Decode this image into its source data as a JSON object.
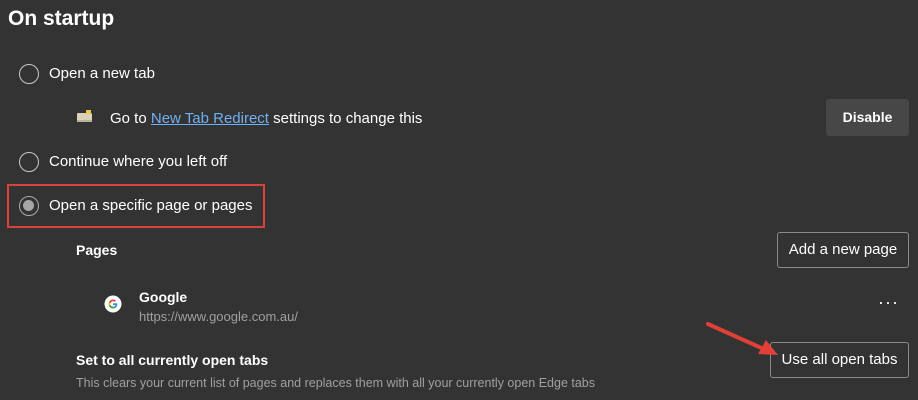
{
  "section": {
    "title": "On startup"
  },
  "options": {
    "new_tab": "Open a new tab",
    "continue": "Continue where you left off",
    "specific": "Open a specific page or pages"
  },
  "redirect": {
    "prefix": "Go to",
    "link": "New Tab Redirect",
    "suffix": "settings to change this",
    "disable_label": "Disable"
  },
  "pages": {
    "heading": "Pages",
    "add_label": "Add a new page",
    "items": [
      {
        "name": "Google",
        "url": "https://www.google.com.au/",
        "more": "···"
      }
    ]
  },
  "open_tabs": {
    "heading": "Set to all currently open tabs",
    "description": "This clears your current list of pages and replaces them with all your currently open Edge tabs",
    "button_label": "Use all open tabs"
  },
  "colors": {
    "background": "#333333",
    "highlight": "#d9413b",
    "link": "#6fb1f2",
    "arrow": "#e04038"
  },
  "icons": {
    "extension": "extension-icon",
    "google": "google-favicon-icon",
    "more": "more-options-icon",
    "arrow": "red-arrow-annotation"
  }
}
